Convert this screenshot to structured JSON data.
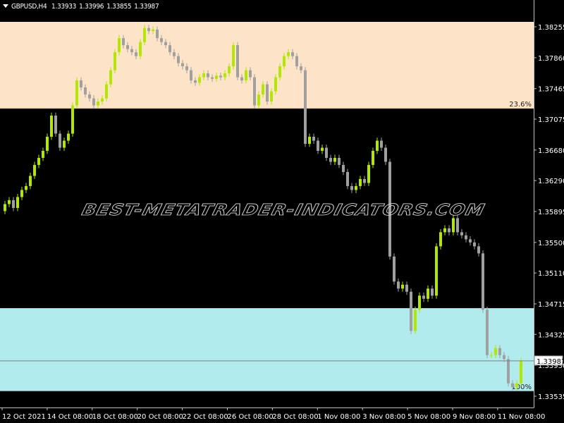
{
  "header": {
    "symbol": "GBPUSD,H4",
    "open": "1.33933",
    "high": "1.33996",
    "low": "1.33855",
    "close": "1.33987"
  },
  "watermark": "BEST-METATRADER-INDICATORS.COM",
  "fib_levels": [
    {
      "label": "23.6%",
      "price": 1.3721,
      "top_price": 1.3859,
      "color": "#fde4c8"
    },
    {
      "label": "100%",
      "price": 1.336,
      "top_price": 1.3466,
      "color": "#b2ebee"
    }
  ],
  "current_price": {
    "value": "1.33987",
    "price": 1.33987
  },
  "price_axis": {
    "max": 1.38255,
    "min": 1.33535,
    "labels": [
      "1.38255",
      "1.37860",
      "1.37465",
      "1.37075",
      "1.36680",
      "1.36290",
      "1.35895",
      "1.35500",
      "1.35110",
      "1.34715",
      "1.34325",
      "1.33930",
      "1.33535"
    ]
  },
  "time_axis": {
    "labels": [
      "12 Oct 2021",
      "14 Oct 08:00",
      "18 Oct 08:00",
      "20 Oct 08:00",
      "22 Oct 08:00",
      "26 Oct 08:00",
      "28 Oct 08:00",
      "1 Nov 08:00",
      "3 Nov 08:00",
      "5 Nov 08:00",
      "9 Nov 08:00",
      "11 Nov 08:00"
    ]
  },
  "colors": {
    "bull": "#b3e600",
    "bear": "#a0a0a0",
    "background": "#000000",
    "axis": "#c0c0c0"
  },
  "chart_data": {
    "type": "candlestick",
    "timeframe": "H4",
    "first_open": 1.359,
    "closes": [
      1.3599,
      1.3604,
      1.3594,
      1.3608,
      1.3617,
      1.3622,
      1.3635,
      1.3649,
      1.3658,
      1.3667,
      1.3685,
      1.3712,
      1.3689,
      1.3671,
      1.368,
      1.3689,
      1.3725,
      1.3757,
      1.3748,
      1.3739,
      1.3734,
      1.3725,
      1.373,
      1.3734,
      1.3752,
      1.377,
      1.3793,
      1.3811,
      1.3802,
      1.3797,
      1.3793,
      1.3788,
      1.3806,
      1.3824,
      1.382,
      1.3822,
      1.3811,
      1.3806,
      1.3802,
      1.3793,
      1.3788,
      1.3779,
      1.3775,
      1.377,
      1.3757,
      1.3754,
      1.3761,
      1.3766,
      1.3761,
      1.3759,
      1.3763,
      1.3761,
      1.3766,
      1.3775,
      1.3802,
      1.3761,
      1.3757,
      1.377,
      1.3761,
      1.3725,
      1.3739,
      1.3752,
      1.373,
      1.3743,
      1.3761,
      1.3775,
      1.3788,
      1.3793,
      1.3788,
      1.3775,
      1.377,
      1.3676,
      1.3685,
      1.368,
      1.3667,
      1.3671,
      1.3658,
      1.3653,
      1.3658,
      1.3649,
      1.364,
      1.3622,
      1.3617,
      1.3622,
      1.3631,
      1.3626,
      1.3649,
      1.3667,
      1.368,
      1.3671,
      1.3653,
      1.3532,
      1.35,
      1.3491,
      1.3496,
      1.3487,
      1.3437,
      1.3464,
      1.3482,
      1.3478,
      1.3491,
      1.3482,
      1.3545,
      1.3563,
      1.3568,
      1.3563,
      1.3581,
      1.3563,
      1.3559,
      1.3554,
      1.355,
      1.3545,
      1.3536,
      1.3464,
      1.3406,
      1.3406,
      1.3415,
      1.3406,
      1.3401,
      1.337,
      1.3365,
      1.337,
      1.33987
    ]
  }
}
